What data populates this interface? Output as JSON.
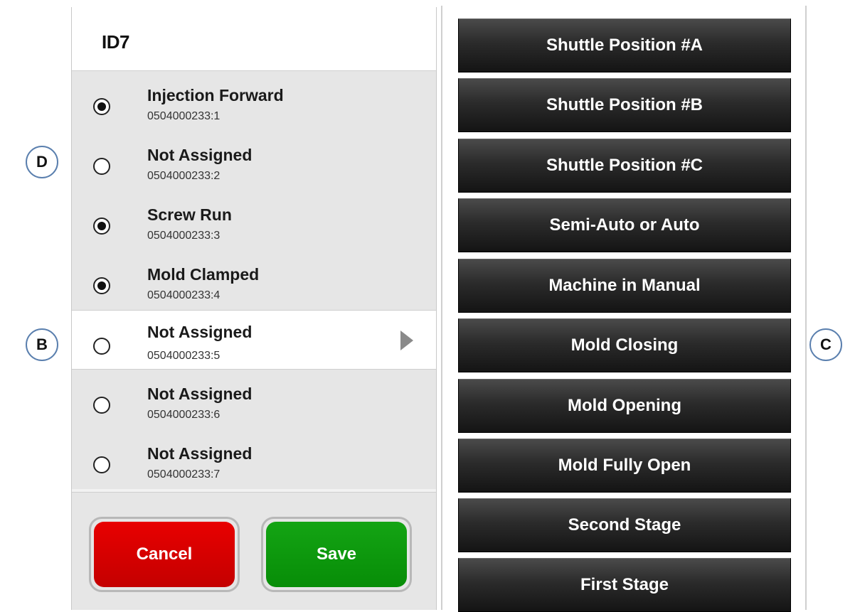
{
  "header": {
    "title": "ID7"
  },
  "rows": [
    {
      "label": "Injection Forward",
      "code": "0504000233:1",
      "checked": true
    },
    {
      "label": "Not Assigned",
      "code": "0504000233:2",
      "checked": false
    },
    {
      "label": "Screw Run",
      "code": "0504000233:3",
      "checked": true
    },
    {
      "label": "Mold Clamped",
      "code": "0504000233:4",
      "checked": true
    },
    {
      "label": "Not Assigned",
      "code": "0504000233:5",
      "checked": false,
      "selected": true
    },
    {
      "label": "Not Assigned",
      "code": "0504000233:6",
      "checked": false
    },
    {
      "label": "Not Assigned",
      "code": "0504000233:7",
      "checked": false
    }
  ],
  "footer": {
    "cancel_label": "Cancel",
    "save_label": "Save"
  },
  "actions": [
    "Shuttle Position #A",
    "Shuttle Position #B",
    "Shuttle Position #C",
    "Semi-Auto or Auto",
    "Machine in Manual",
    "Mold Closing",
    "Mold Opening",
    "Mold Fully Open",
    "Second Stage",
    "First Stage"
  ],
  "callouts": {
    "d": "D",
    "b": "B",
    "c": "C"
  },
  "colors": {
    "cancel": "#d40000",
    "save": "#0b960b",
    "action_button": "#2b2b2b",
    "callout_border": "#5a7fae"
  },
  "icons": {
    "radio_checked": "radio-checked-icon",
    "radio_unchecked": "radio-unchecked-icon",
    "arrow": "triangle-right-icon"
  }
}
